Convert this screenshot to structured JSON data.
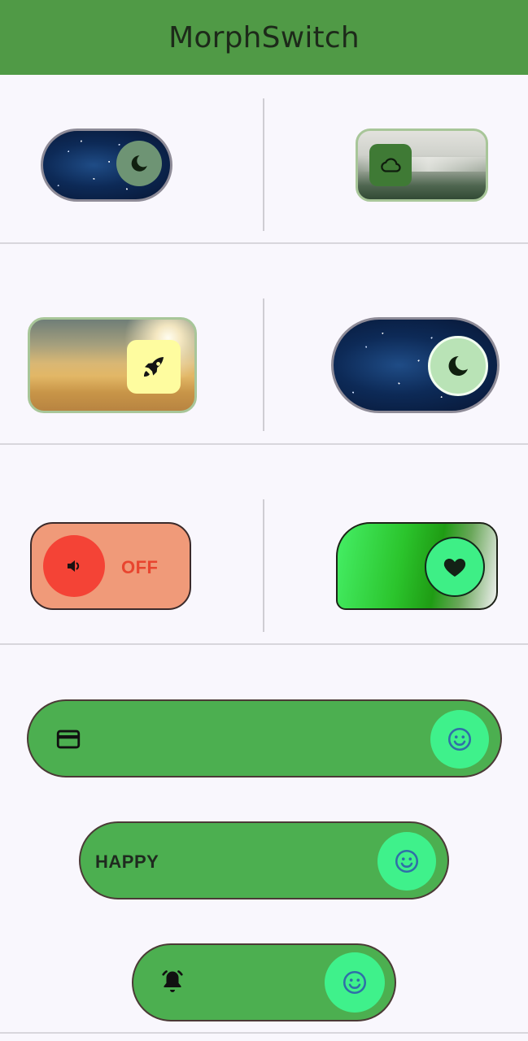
{
  "app": {
    "title": "MorphSwitch"
  },
  "colors": {
    "appbar": "#509a46",
    "background": "#f9f7fd",
    "pill_track": "#4caf50",
    "pill_knob": "#3ff18b",
    "sound_track": "#f09a79",
    "sound_knob": "#f44336"
  },
  "switches": [
    {
      "id": "night-small",
      "knob_icon": "moon-icon",
      "state": "on"
    },
    {
      "id": "fog-cloud",
      "knob_icon": "cloud-icon",
      "state": "off"
    },
    {
      "id": "desert-rocket",
      "knob_icon": "rocket-icon",
      "state": "on"
    },
    {
      "id": "night-large",
      "knob_icon": "moon-icon",
      "state": "on"
    },
    {
      "id": "sound",
      "knob_icon": "volume-icon",
      "label": "OFF",
      "state": "off"
    },
    {
      "id": "heart",
      "knob_icon": "heart-icon",
      "state": "on"
    },
    {
      "id": "card-pill",
      "leading_icon": "credit-card-icon",
      "knob_icon": "smiley-icon",
      "state": "on"
    },
    {
      "id": "happy-pill",
      "label": "HAPPY",
      "knob_icon": "smiley-icon",
      "state": "on"
    },
    {
      "id": "alarm-pill",
      "leading_icon": "alarm-bell-icon",
      "knob_icon": "smiley-icon",
      "state": "on"
    }
  ]
}
